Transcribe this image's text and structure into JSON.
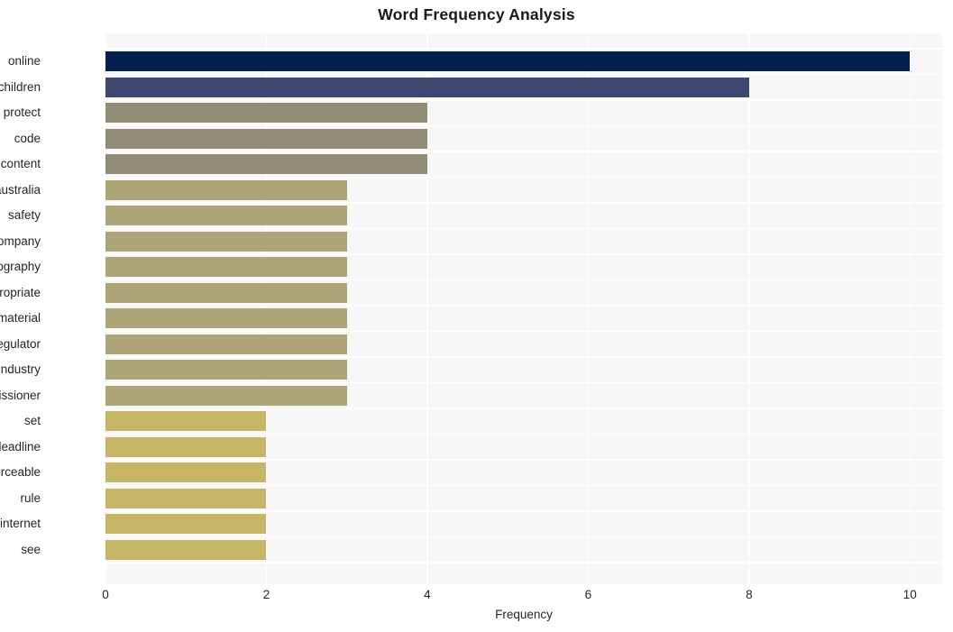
{
  "chart_data": {
    "type": "bar",
    "orientation": "horizontal",
    "title": "Word Frequency Analysis",
    "xlabel": "Frequency",
    "ylabel": "",
    "xlim": [
      0,
      10.4
    ],
    "xticks": [
      "0",
      "2",
      "4",
      "6",
      "8",
      "10"
    ],
    "xtick_values": [
      0,
      2,
      4,
      6,
      8,
      10
    ],
    "grid": true,
    "legend": null,
    "categories": [
      "online",
      "children",
      "protect",
      "code",
      "content",
      "australia",
      "safety",
      "company",
      "pornography",
      "inappropriate",
      "material",
      "regulator",
      "industry",
      "commissioner",
      "set",
      "deadline",
      "enforceable",
      "rule",
      "internet",
      "see"
    ],
    "values": [
      10,
      8,
      4,
      4,
      4,
      3,
      3,
      3,
      3,
      3,
      3,
      3,
      3,
      3,
      2,
      2,
      2,
      2,
      2,
      2
    ],
    "bar_colors": [
      "#04204f",
      "#3d4770",
      "#918d77",
      "#918d77",
      "#908c76",
      "#ada578",
      "#ada578",
      "#ada578",
      "#ada578",
      "#ada578",
      "#ada578",
      "#ada578",
      "#ada578",
      "#ada578",
      "#c6b564",
      "#c6b564",
      "#c6b564",
      "#c6b564",
      "#c6b564",
      "#c6b564"
    ],
    "plot_background": "#f7f7f7",
    "gridline_color": "#ffffff",
    "figure_background": "#ffffff"
  }
}
